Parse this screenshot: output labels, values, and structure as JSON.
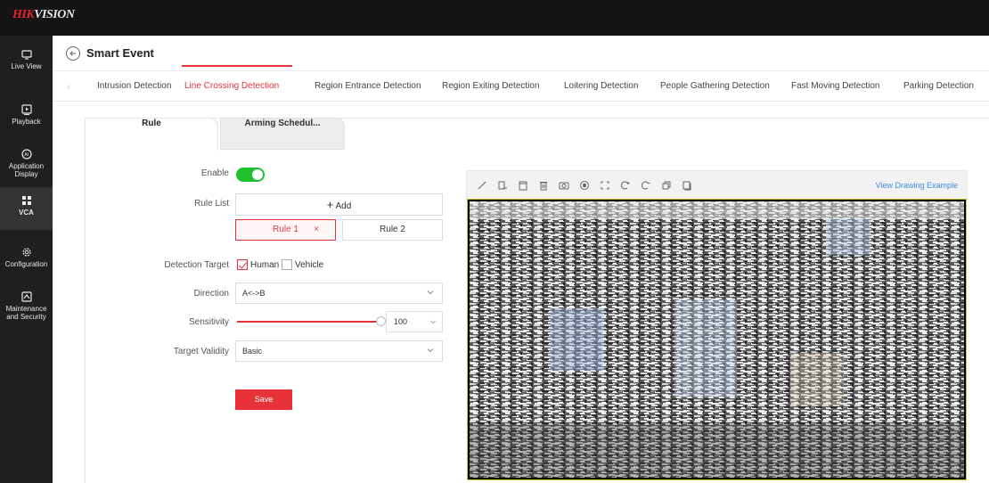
{
  "brand": {
    "part1": "HIK",
    "part2": "VISION"
  },
  "sidebar": {
    "items": [
      {
        "label": "Live View",
        "icon": "monitor-icon"
      },
      {
        "label": "Playback",
        "icon": "play-icon"
      },
      {
        "label": "Application Display",
        "icon": "ai-icon"
      },
      {
        "label": "VCA",
        "icon": "grid-icon",
        "active": true
      },
      {
        "label": "Configuration",
        "icon": "gear-icon"
      },
      {
        "label": "Maintenance and Security",
        "icon": "shield-icon"
      }
    ]
  },
  "page": {
    "title": "Smart Event"
  },
  "tabs": [
    {
      "label": "Intrusion Detection"
    },
    {
      "label": "Line Crossing Detection",
      "active": true
    },
    {
      "label": "Region Entrance Detection"
    },
    {
      "label": "Region Exiting Detection"
    },
    {
      "label": "Loitering Detection"
    },
    {
      "label": "People Gathering Detection"
    },
    {
      "label": "Fast Moving Detection"
    },
    {
      "label": "Parking Detection"
    }
  ],
  "subtabs": {
    "rule": "Rule",
    "arming": "Arming Schedul..."
  },
  "form": {
    "enable_label": "Enable",
    "enable_on": true,
    "rule_list_label": "Rule List",
    "add_label": "Add",
    "rules": [
      "Rule 1",
      "Rule 2"
    ],
    "detection_target_label": "Detection Target",
    "targets": [
      {
        "label": "Human",
        "checked": true
      },
      {
        "label": "Vehicle",
        "checked": false
      }
    ],
    "direction_label": "Direction",
    "direction_value": "A<->B",
    "sensitivity_label": "Sensitivity",
    "sensitivity_value": "100",
    "target_validity_label": "Target Validity",
    "target_validity_value": "Basic",
    "save_label": "Save"
  },
  "video": {
    "view_example": "View Drawing Example",
    "tools": [
      "line-tool-icon",
      "rect-tool-icon",
      "clear-icon",
      "delete-icon",
      "snapshot-icon",
      "record-icon",
      "fullscreen-icon",
      "zoom-in-icon",
      "zoom-out-icon",
      "copy-icon",
      "paste-icon"
    ]
  },
  "colors": {
    "accent": "#e7323a",
    "toggle_on": "#1ec02b",
    "link": "#3a8de0"
  }
}
